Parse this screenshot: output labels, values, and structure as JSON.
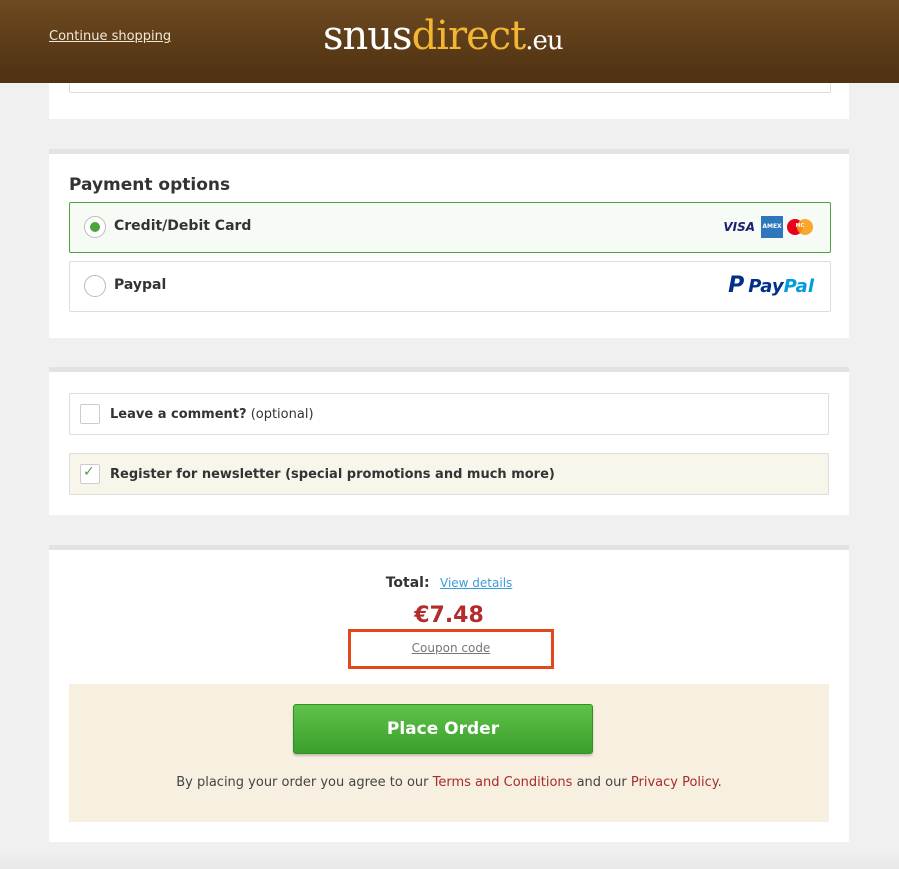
{
  "header": {
    "continue_label": "Continue shopping",
    "logo_part1": "snus",
    "logo_part2": "direct",
    "logo_part3": ".eu"
  },
  "payment": {
    "title": "Payment options",
    "options": [
      {
        "label": "Credit/Debit Card",
        "selected": true,
        "logos": [
          "VISA",
          "AMERICAN EXPRESS",
          "MasterCard"
        ]
      },
      {
        "label": "Paypal",
        "selected": false,
        "logo": "PayPal"
      }
    ]
  },
  "extras": {
    "comment_label": "Leave a comment?",
    "comment_optional": "(optional)",
    "comment_checked": false,
    "newsletter_label": "Register for newsletter (special promotions and much more)",
    "newsletter_checked": true
  },
  "summary": {
    "total_label": "Total:",
    "view_details": "View details",
    "price": "€7.48",
    "coupon_label": "Coupon code"
  },
  "order": {
    "place_order": "Place Order",
    "agree_prefix": "By placing your order you agree to our",
    "terms": "Terms and Conditions",
    "and_our": "and our",
    "privacy": "Privacy Policy",
    "period": "."
  },
  "colors": {
    "accent_green": "#4fa33e",
    "price_red": "#b32b2b",
    "highlight_orange": "#e2481a",
    "header_brown": "#5a3a17",
    "logo_yellow": "#f2b632"
  }
}
